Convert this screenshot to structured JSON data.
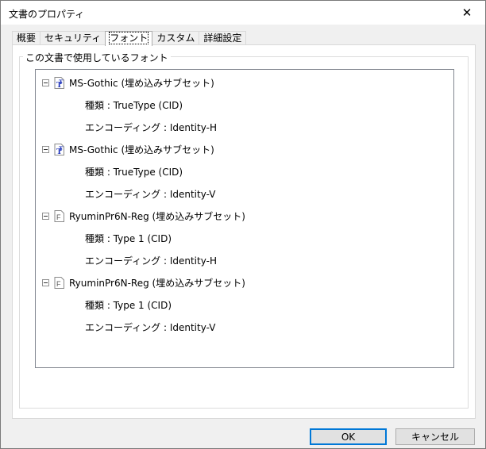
{
  "window": {
    "title": "文書のプロパティ",
    "close_glyph": "✕"
  },
  "tabs": [
    {
      "label": "概要",
      "active": false
    },
    {
      "label": "セキュリティ",
      "active": false
    },
    {
      "label": "フォント",
      "active": true
    },
    {
      "label": "カスタム",
      "active": false
    },
    {
      "label": "詳細設定",
      "active": false
    }
  ],
  "group": {
    "legend": "この文書で使用しているフォント"
  },
  "fonts": [
    {
      "name": "MS-Gothic (埋め込みサブセット)",
      "icon": "truetype-font-icon",
      "type_line": "種類 : TrueType (CID)",
      "encoding_line": "エンコーディング : Identity-H"
    },
    {
      "name": "MS-Gothic (埋め込みサブセット)",
      "icon": "truetype-font-icon",
      "type_line": "種類 : TrueType (CID)",
      "encoding_line": "エンコーディング : Identity-V"
    },
    {
      "name": "RyuminPr6N-Reg (埋め込みサブセット)",
      "icon": "type1-font-icon",
      "type_line": "種類 : Type 1 (CID)",
      "encoding_line": "エンコーディング : Identity-H"
    },
    {
      "name": "RyuminPr6N-Reg (埋め込みサブセット)",
      "icon": "type1-font-icon",
      "type_line": "種類 : Type 1 (CID)",
      "encoding_line": "エンコーディング : Identity-V"
    }
  ],
  "buttons": {
    "ok": "OK",
    "cancel": "キャンセル"
  }
}
